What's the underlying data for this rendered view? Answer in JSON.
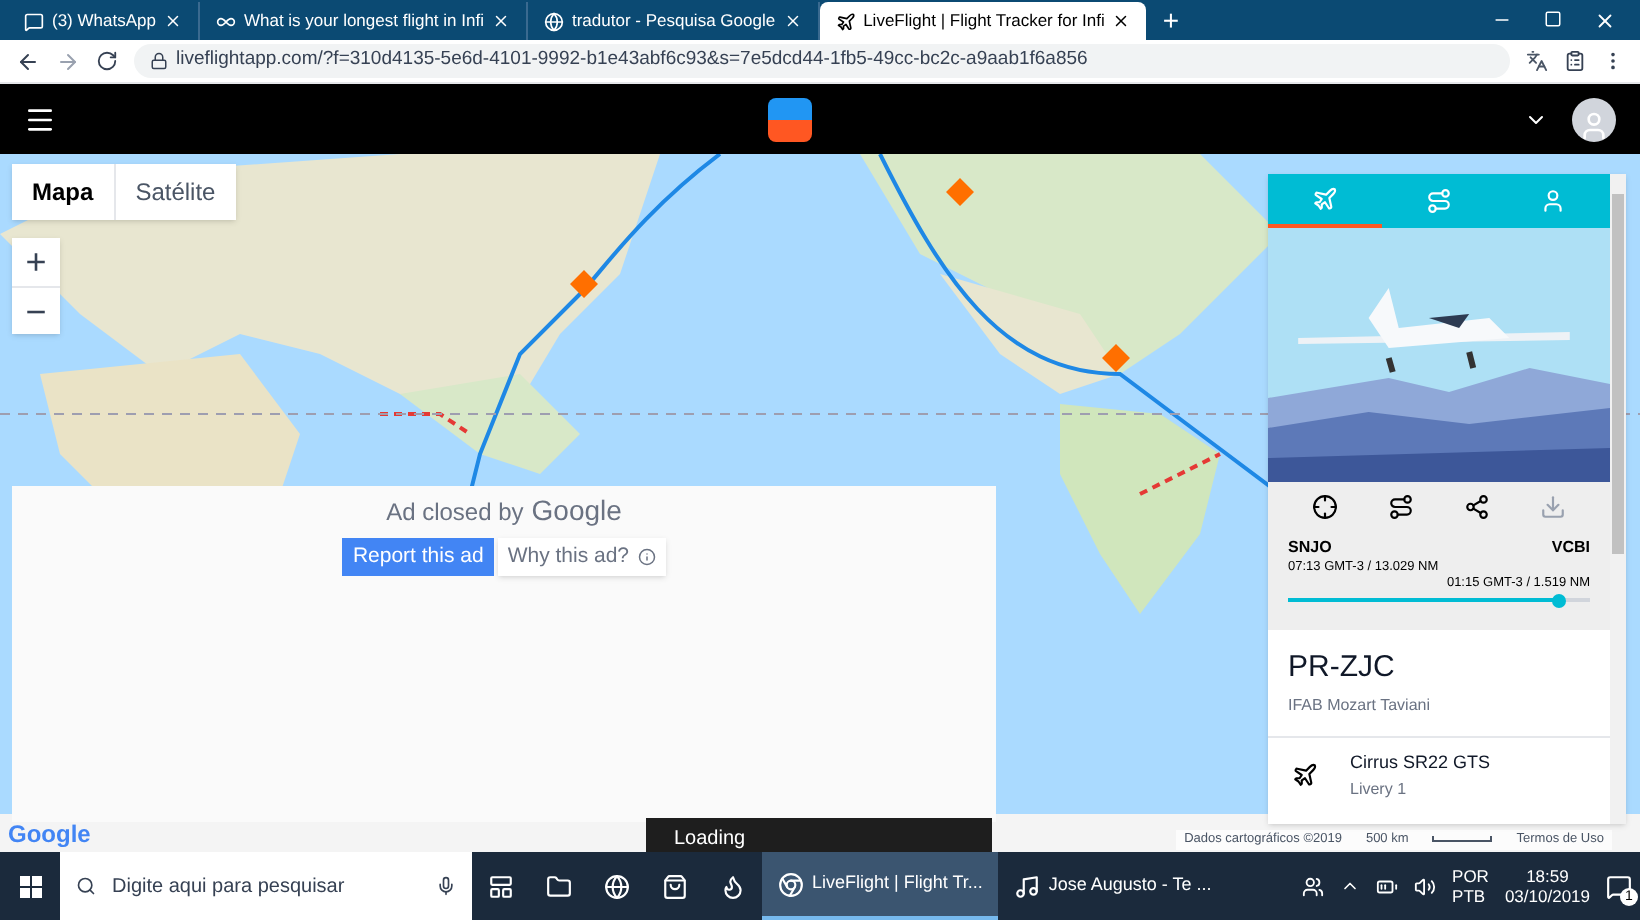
{
  "browser": {
    "tabs": [
      {
        "title": "(3) WhatsApp",
        "kind": "whatsapp",
        "selected": false
      },
      {
        "title": "What is your longest flight in Infi",
        "kind": "infinity",
        "selected": false
      },
      {
        "title": "tradutor - Pesquisa Google",
        "kind": "google",
        "selected": false
      },
      {
        "title": "LiveFlight | Flight Tracker for Infi",
        "kind": "liveflight",
        "selected": true
      }
    ],
    "new_tab": "+",
    "url": "liveflightapp.com/?f=310d4135-5e6d-4101-9992-b1e43abf6c93&s=7e5dcd44-1fb5-49cc-bc2c-a9aab1f6a856"
  },
  "map": {
    "map_types": [
      {
        "label": "Mapa",
        "selected": true
      },
      {
        "label": "Satélite",
        "selected": false
      }
    ],
    "zoom_in": "+",
    "zoom_out": "−",
    "ad": {
      "closed_by": "Ad closed by",
      "brand": "Google",
      "report": "Report this ad",
      "why": "Why this ad?"
    },
    "loading": "Loading",
    "logo": "Google",
    "footer": {
      "credits": "Dados cartográficos ©2019",
      "scale": "500 km",
      "terms": "Termos de Uso"
    }
  },
  "panel": {
    "tabs": [
      {
        "kind": "plane",
        "selected": true
      },
      {
        "kind": "route",
        "selected": false
      },
      {
        "kind": "person",
        "selected": false
      }
    ],
    "actions": [
      {
        "kind": "locate",
        "disabled": false
      },
      {
        "kind": "route",
        "disabled": false
      },
      {
        "kind": "share",
        "disabled": false
      },
      {
        "kind": "download",
        "disabled": true
      }
    ],
    "origin": "SNJO",
    "destination": "VCBI",
    "origin_info": "07:13 GMT-3 / 13.029 NM",
    "destination_info": "01:15 GMT-3 / 1.519 NM",
    "progress": {
      "level": 0.9
    },
    "callsign": "PR-ZJC",
    "pilot": "IFAB Mozart Taviani",
    "aircraft": "Cirrus SR22 GTS",
    "livery": "Livery 1"
  },
  "taskbar": {
    "search_placeholder": "Digite aqui para pesquisar",
    "apps": [
      {
        "kind": "taskview",
        "active": false
      },
      {
        "kind": "explorer",
        "active": false
      },
      {
        "kind": "edge",
        "active": false
      },
      {
        "kind": "store",
        "active": false
      },
      {
        "kind": "firefox",
        "active": false
      },
      {
        "kind": "chrome",
        "label": "LiveFlight | Flight Tr...",
        "active": true
      },
      {
        "kind": "spotify",
        "label": "Jose Augusto - Te ...",
        "active": false
      }
    ],
    "language": [
      "POR",
      "PTB"
    ],
    "time": "18:59",
    "date": "03/10/2019",
    "notifications": "1"
  }
}
